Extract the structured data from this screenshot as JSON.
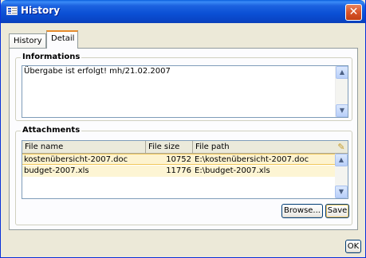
{
  "window": {
    "title": "History",
    "close_glyph": "✕"
  },
  "tabs": [
    {
      "label": "History",
      "active": false
    },
    {
      "label": "Detail",
      "active": true
    }
  ],
  "informations": {
    "legend": "Informations",
    "text": "Übergabe ist erfolgt! mh/21.02.2007"
  },
  "attachments": {
    "legend": "Attachments",
    "columns": [
      "File name",
      "File size",
      "File path"
    ],
    "rows": [
      {
        "name": "kostenübersicht-2007.doc",
        "size": "10752",
        "path": "E:\\kostenübersicht-2007.doc",
        "selected": true
      },
      {
        "name": "budget-2007.xls",
        "size": "11776",
        "path": "E:\\budget-2007.xls",
        "selected": false
      }
    ],
    "browse_label": "Browse...",
    "save_label": "Save"
  },
  "footer": {
    "ok_label": "OK"
  },
  "icons": {
    "scroll_up": "▲",
    "scroll_down": "▼",
    "column_chooser": "✎"
  },
  "colors": {
    "titlebar": "#0a4fd4",
    "selection": "#fdf3cf",
    "window_bg": "#ece9d8"
  }
}
